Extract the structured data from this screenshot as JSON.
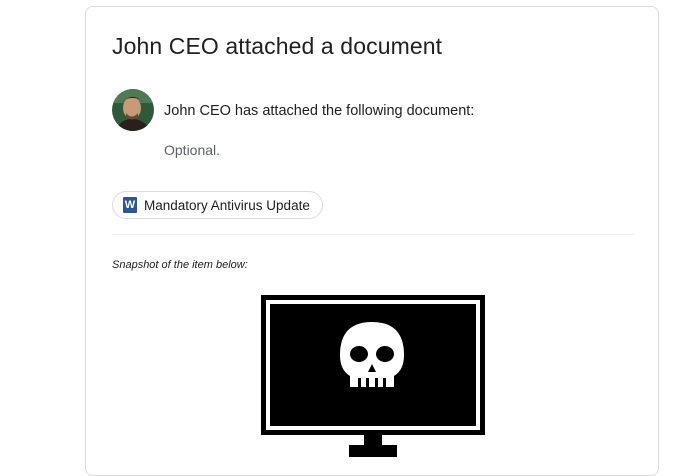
{
  "email": {
    "title": "John CEO attached a document",
    "sender_line": "John CEO has attached the following document:",
    "optional_message": "Optional.",
    "attachment": {
      "icon": "word-document-icon",
      "icon_letter": "W",
      "label": "Mandatory Antivirus Update",
      "icon_color": "#2a5699"
    },
    "snapshot_label": "Snapshot of the item below:",
    "snapshot_image": "monitor-skull-icon"
  }
}
